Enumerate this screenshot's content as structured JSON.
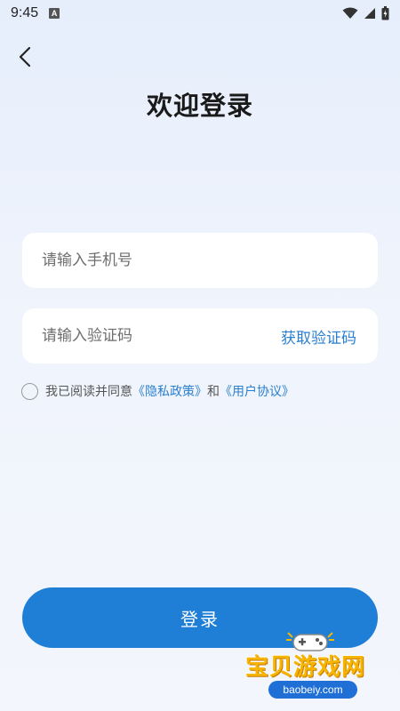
{
  "status_bar": {
    "time": "9:45",
    "notification_icon": "a-notification-icon",
    "icons": [
      "wifi-icon",
      "signal-icon",
      "battery-icon"
    ]
  },
  "header": {
    "back_icon": "chevron-left-icon",
    "title": "欢迎登录"
  },
  "form": {
    "phone_placeholder": "请输入手机号",
    "code_placeholder": "请输入验证码",
    "get_code_label": "获取验证码"
  },
  "agreement": {
    "prefix": "我已阅读并同意",
    "privacy_link": "《隐私政策》",
    "conjunction": "和",
    "terms_link": "《用户协议》",
    "checked": false
  },
  "login_button": {
    "label": "登录"
  },
  "watermark": {
    "title": "宝贝游戏网",
    "url": "baobeiy.com"
  },
  "colors": {
    "accent": "#1f7fd6",
    "link": "#2a7fd0",
    "background_top": "#e6eefc",
    "background_bottom": "#f3f6fc",
    "watermark_gold": "#f7b500"
  }
}
